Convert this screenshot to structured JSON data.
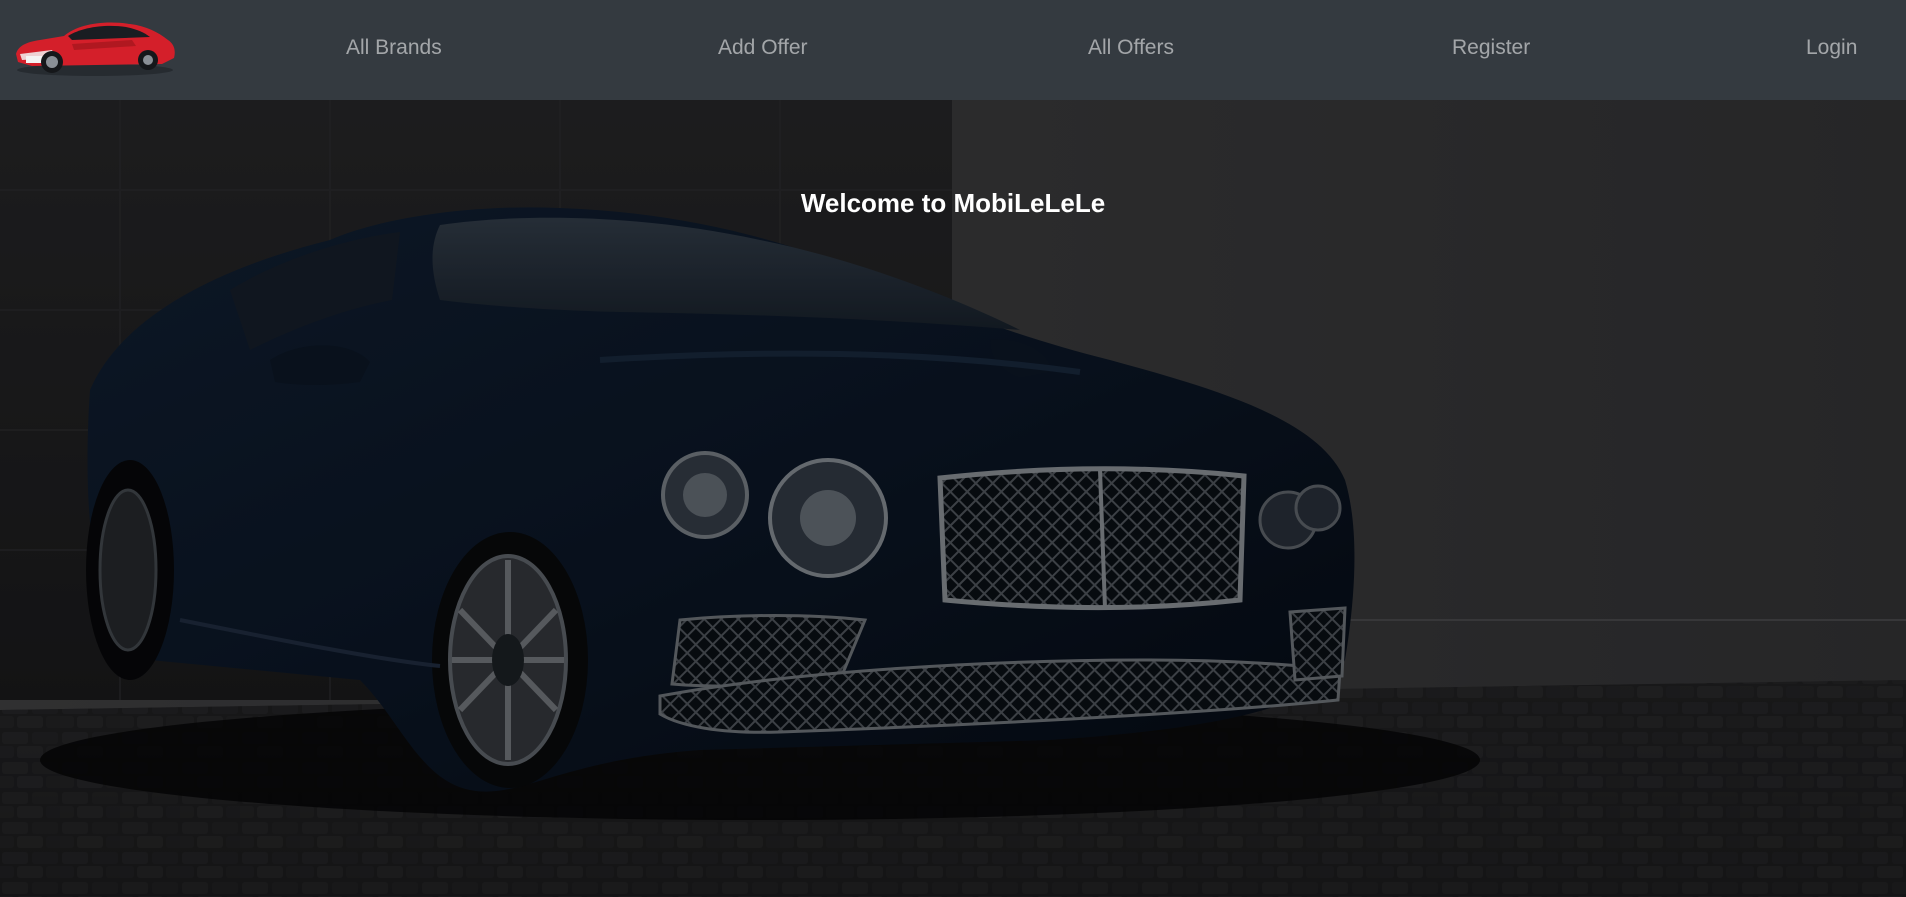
{
  "nav": {
    "logo_alt": "red sports car logo",
    "links": [
      {
        "label": "All Brands"
      },
      {
        "label": "Add Offer"
      },
      {
        "label": "All Offers"
      },
      {
        "label": "Register"
      },
      {
        "label": "Login"
      }
    ]
  },
  "hero": {
    "title": "Welcome to MobiLeLeLe",
    "image_icon": "luxury-car-photo"
  },
  "colors": {
    "navbar_bg": "#343a40",
    "nav_link": "#a6a9ac",
    "hero_title": "#ffffff",
    "logo_car": "#e0202a"
  }
}
